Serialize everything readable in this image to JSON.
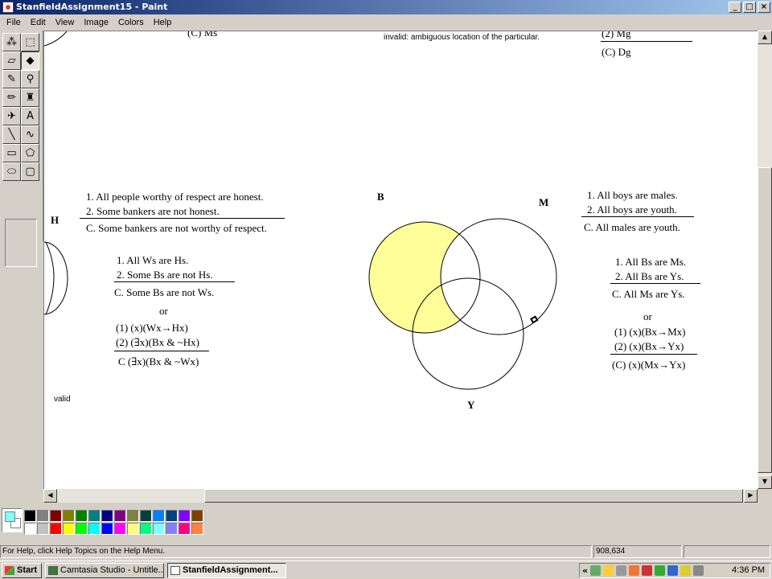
{
  "window": {
    "title": "StanfieldAssignment15 - Paint",
    "min": "_",
    "max": "□",
    "close": "×"
  },
  "menu": [
    "File",
    "Edit",
    "View",
    "Image",
    "Colors",
    "Help"
  ],
  "tools": [
    {
      "name": "free-form-select-tool",
      "glyph": "⁂"
    },
    {
      "name": "select-tool",
      "glyph": "⬚"
    },
    {
      "name": "eraser-tool",
      "glyph": "▱"
    },
    {
      "name": "fill-tool",
      "glyph": "◆"
    },
    {
      "name": "pick-color-tool",
      "glyph": "✎"
    },
    {
      "name": "magnifier-tool",
      "glyph": "⚲"
    },
    {
      "name": "pencil-tool",
      "glyph": "✏"
    },
    {
      "name": "brush-tool",
      "glyph": "♜"
    },
    {
      "name": "airbrush-tool",
      "glyph": "✈"
    },
    {
      "name": "text-tool",
      "glyph": "A"
    },
    {
      "name": "line-tool",
      "glyph": "╲"
    },
    {
      "name": "curve-tool",
      "glyph": "∿"
    },
    {
      "name": "rectangle-tool",
      "glyph": "▭"
    },
    {
      "name": "polygon-tool",
      "glyph": "⬠"
    },
    {
      "name": "ellipse-tool",
      "glyph": "⬭"
    },
    {
      "name": "rounded-rectangle-tool",
      "glyph": "▢"
    }
  ],
  "canvas": {
    "top_left_partial": "(C) Ms",
    "invalid_note": "invalid: ambiguous location of the particular.",
    "top_right_p2": "(2) Mg",
    "top_right_c": "(C) Dg",
    "arg1": {
      "p1": "1. All people worthy of respect are honest.",
      "p2": "2. Some bankers are not honest.",
      "c": "C. Some bankers are not worthy of respect."
    },
    "label_h": "H",
    "arg2": {
      "p1": "1. All Ws are Hs.",
      "p2": "2. Some Bs are not Hs.",
      "c": "C. Some Bs are not Ws.",
      "or": "or",
      "f1": "(1) (x)(Wx→Hx)",
      "f2": "(2) (∃x)(Bx & ~Hx)",
      "fc": "C  (∃x)(Bx & ~Wx)"
    },
    "valid_note": "valid",
    "venn": {
      "label_b": "B",
      "label_m": "M",
      "label_y": "Y",
      "shade_color": "#ffff99"
    },
    "arg3": {
      "p1": "1. All boys are males.",
      "p2": "2. All boys are youth.",
      "c": "C. All males are youth."
    },
    "arg4": {
      "p1": "1. All Bs are Ms.",
      "p2": "2. All Bs are Ys.",
      "c": "C. All Ms are Ys.",
      "or": "or",
      "f1": "(1) (x)(Bx→Mx)",
      "f2": "(2) (x)(Bx→Yx)",
      "fc": "(C) (x)(Mx→Yx)"
    }
  },
  "palette": {
    "foreground": "#80ffff",
    "background": "#ffffff",
    "colors": [
      "#000000",
      "#808080",
      "#800000",
      "#808000",
      "#008000",
      "#008080",
      "#000080",
      "#800080",
      "#808040",
      "#004040",
      "#0080ff",
      "#004080",
      "#8000ff",
      "#804000",
      "#ffffff",
      "#c0c0c0",
      "#ff0000",
      "#ffff00",
      "#00ff00",
      "#00ffff",
      "#0000ff",
      "#ff00ff",
      "#ffff80",
      "#00ff80",
      "#80ffff",
      "#8080ff",
      "#ff0080",
      "#ff8040"
    ]
  },
  "status": {
    "help": "For Help, click Help Topics on the Help Menu.",
    "coords": "908,634"
  },
  "taskbar": {
    "start": "Start",
    "tasks": [
      {
        "label": "Camtasia Studio - Untitle...",
        "active": false
      },
      {
        "label": "StanfieldAssignment...",
        "active": true
      }
    ],
    "tray_arrow": "«",
    "clock": "4:36 PM"
  }
}
